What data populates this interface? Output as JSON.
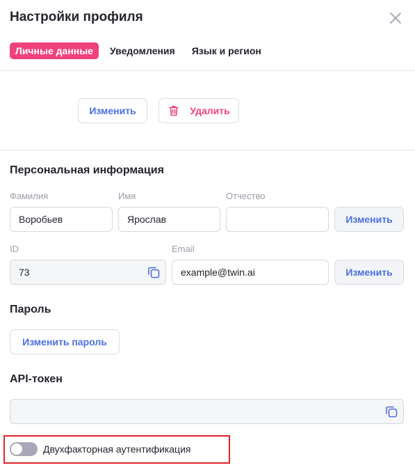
{
  "modal": {
    "title": "Настройки профиля"
  },
  "tabs": [
    {
      "label": "Личные данные",
      "active": true
    },
    {
      "label": "Уведомления",
      "active": false
    },
    {
      "label": "Язык и регион",
      "active": false
    }
  ],
  "avatar_actions": {
    "change_label": "Изменить",
    "delete_label": "Удалить"
  },
  "personal": {
    "title": "Персональная информация",
    "last_name_label": "Фамилия",
    "last_name_value": "Воробьев",
    "first_name_label": "Имя",
    "first_name_value": "Ярослав",
    "middle_name_label": "Отчество",
    "middle_name_value": "",
    "change_name_label": "Изменить",
    "id_label": "ID",
    "id_value": "73",
    "email_label": "Email",
    "email_value": "example@twin.ai",
    "change_email_label": "Изменить"
  },
  "password": {
    "title": "Пароль",
    "change_label": "Изменить пароль"
  },
  "api": {
    "title": "API-токен",
    "value": ""
  },
  "two_factor": {
    "label": "Двухфакторная аутентификация",
    "enabled": false
  },
  "colors": {
    "accent": "#4a6fe0",
    "brand_pink": "#f0427a",
    "highlight_red": "#e0252d"
  },
  "icons": {
    "close": "close-icon",
    "trash": "trash-icon",
    "copy": "copy-icon"
  }
}
